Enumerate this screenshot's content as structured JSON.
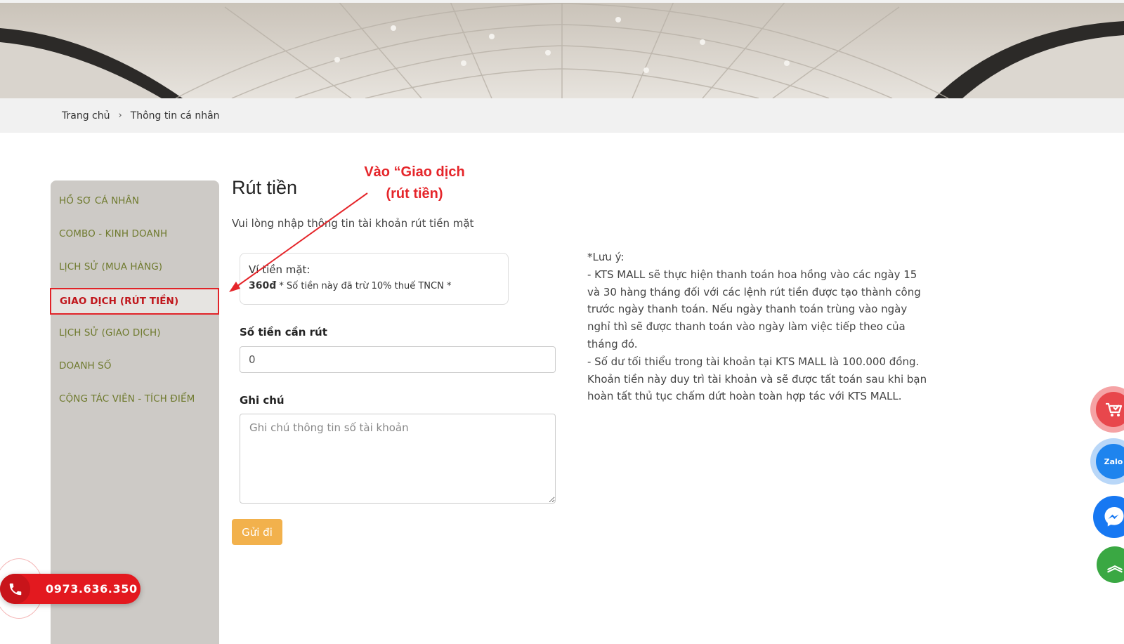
{
  "breadcrumb": {
    "home": "Trang chủ",
    "separator": "›",
    "current": "Thông tin cá nhân"
  },
  "sidebar": {
    "items": [
      {
        "label": "HỒ SƠ CÁ NHÂN"
      },
      {
        "label": "COMBO - KINH DOANH"
      },
      {
        "label": "LỊCH SỬ (MUA HÀNG)"
      },
      {
        "label": "GIAO DỊCH (RÚT TIỀN)",
        "active": true
      },
      {
        "label": "LỊCH SỬ (GIAO DỊCH)"
      },
      {
        "label": "DOANH SỐ"
      },
      {
        "label": "CỘNG TÁC VIÊN - TÍCH ĐIỂM"
      }
    ]
  },
  "main": {
    "title": "Rút tiền",
    "subtitle": "Vui lòng nhập thông tin tài khoản rút tiền mặt",
    "wallet": {
      "label": "Ví tiền mặt:",
      "amount": "360đ",
      "note": "* Số tiền này đã trừ 10% thuế TNCN *"
    },
    "amount_field": {
      "label": "Số tiền cần rút",
      "value": "0"
    },
    "note_field": {
      "label": "Ghi chú",
      "placeholder": "Ghi chú thông tin số tài khoản"
    },
    "submit_label": "Gửi đi"
  },
  "notes": {
    "heading": "*Lưu ý:",
    "line1": "- KTS MALL sẽ thực hiện thanh toán hoa hồng vào các ngày 15 và 30 hàng tháng đối với các lệnh rút tiền được tạo thành công trước ngày thanh toán. Nếu ngày thanh toán trùng vào ngày nghỉ thì sẽ được thanh toán vào ngày làm việc tiếp theo của tháng đó.",
    "line2": "- Số dư tối thiểu trong tài khoản tại KTS MALL là 100.000 đồng. Khoản tiền này duy trì tài khoản và sẽ được tất toán sau khi bạn hoàn tất thủ tục chấm dứt hoàn toàn hợp tác với KTS MALL."
  },
  "annotation": {
    "line1": "Vào “Giao dịch",
    "line2": "(rút tiền)"
  },
  "contact": {
    "phone": "0973.636.350"
  },
  "floating": {
    "zalo_text": "Zalo",
    "top_symbol": "︽"
  },
  "colors": {
    "accent_red": "#e3191f",
    "sidebar_bg": "#cdcac6",
    "sidebar_text": "#6f7a2e",
    "submit_bg": "#f2b14c",
    "zalo_blue": "#1e84ee",
    "messenger_blue": "#1778f2",
    "top_green": "#3aa843"
  },
  "icons": [
    "chevron-right-icon",
    "phone-icon",
    "cart-check-icon",
    "zalo-icon",
    "messenger-icon",
    "arrow-up-icon"
  ]
}
